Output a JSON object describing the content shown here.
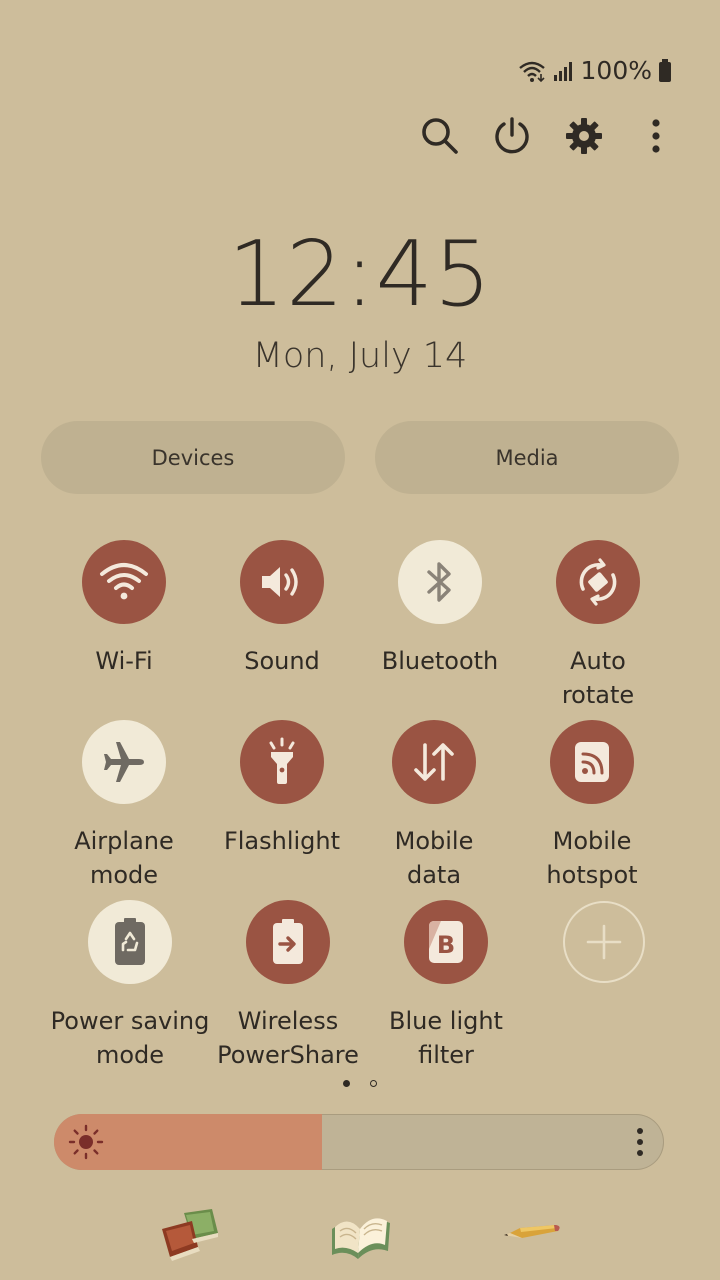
{
  "status_bar": {
    "battery_text": "100%"
  },
  "top_icons": [
    "search-icon",
    "power-icon",
    "settings-gear-icon",
    "more-vertical-icon"
  ],
  "clock": {
    "time": "12:45",
    "date": "Mon, July 14"
  },
  "pills": {
    "devices": "Devices",
    "media": "Media"
  },
  "tiles": [
    {
      "label": "Wi-Fi",
      "state": "on",
      "icon": "wifi-icon"
    },
    {
      "label": "Sound",
      "state": "on",
      "icon": "sound-icon"
    },
    {
      "label": "Bluetooth",
      "state": "off",
      "icon": "bluetooth-icon"
    },
    {
      "label": "Auto\nrotate",
      "state": "on",
      "icon": "auto-rotate-icon"
    },
    {
      "label": "Airplane\nmode",
      "state": "off",
      "icon": "airplane-icon"
    },
    {
      "label": "Flashlight",
      "state": "on",
      "icon": "flashlight-icon"
    },
    {
      "label": "Mobile\ndata",
      "state": "on",
      "icon": "mobile-data-icon"
    },
    {
      "label": "Mobile\nhotspot",
      "state": "on",
      "icon": "hotspot-icon"
    },
    {
      "label": "Power saving\nmode",
      "state": "off",
      "icon": "power-saving-icon"
    },
    {
      "label": "Wireless\nPowerShare",
      "state": "on",
      "icon": "wireless-powershare-icon"
    },
    {
      "label": "Blue light\nfilter",
      "state": "on",
      "icon": "blue-light-filter-icon"
    }
  ],
  "add_tile": {
    "icon": "add-icon"
  },
  "pager": {
    "current": 1,
    "total": 2
  },
  "brightness": {
    "level": 0.44
  },
  "dock": [
    "books-icon",
    "open-book-icon",
    "pencil-icon"
  ],
  "colors": {
    "background": "#cdbd9b",
    "tile_on": "#9a5443",
    "tile_off": "#f1ead7",
    "brightness_fill": "#cd8a6a"
  }
}
